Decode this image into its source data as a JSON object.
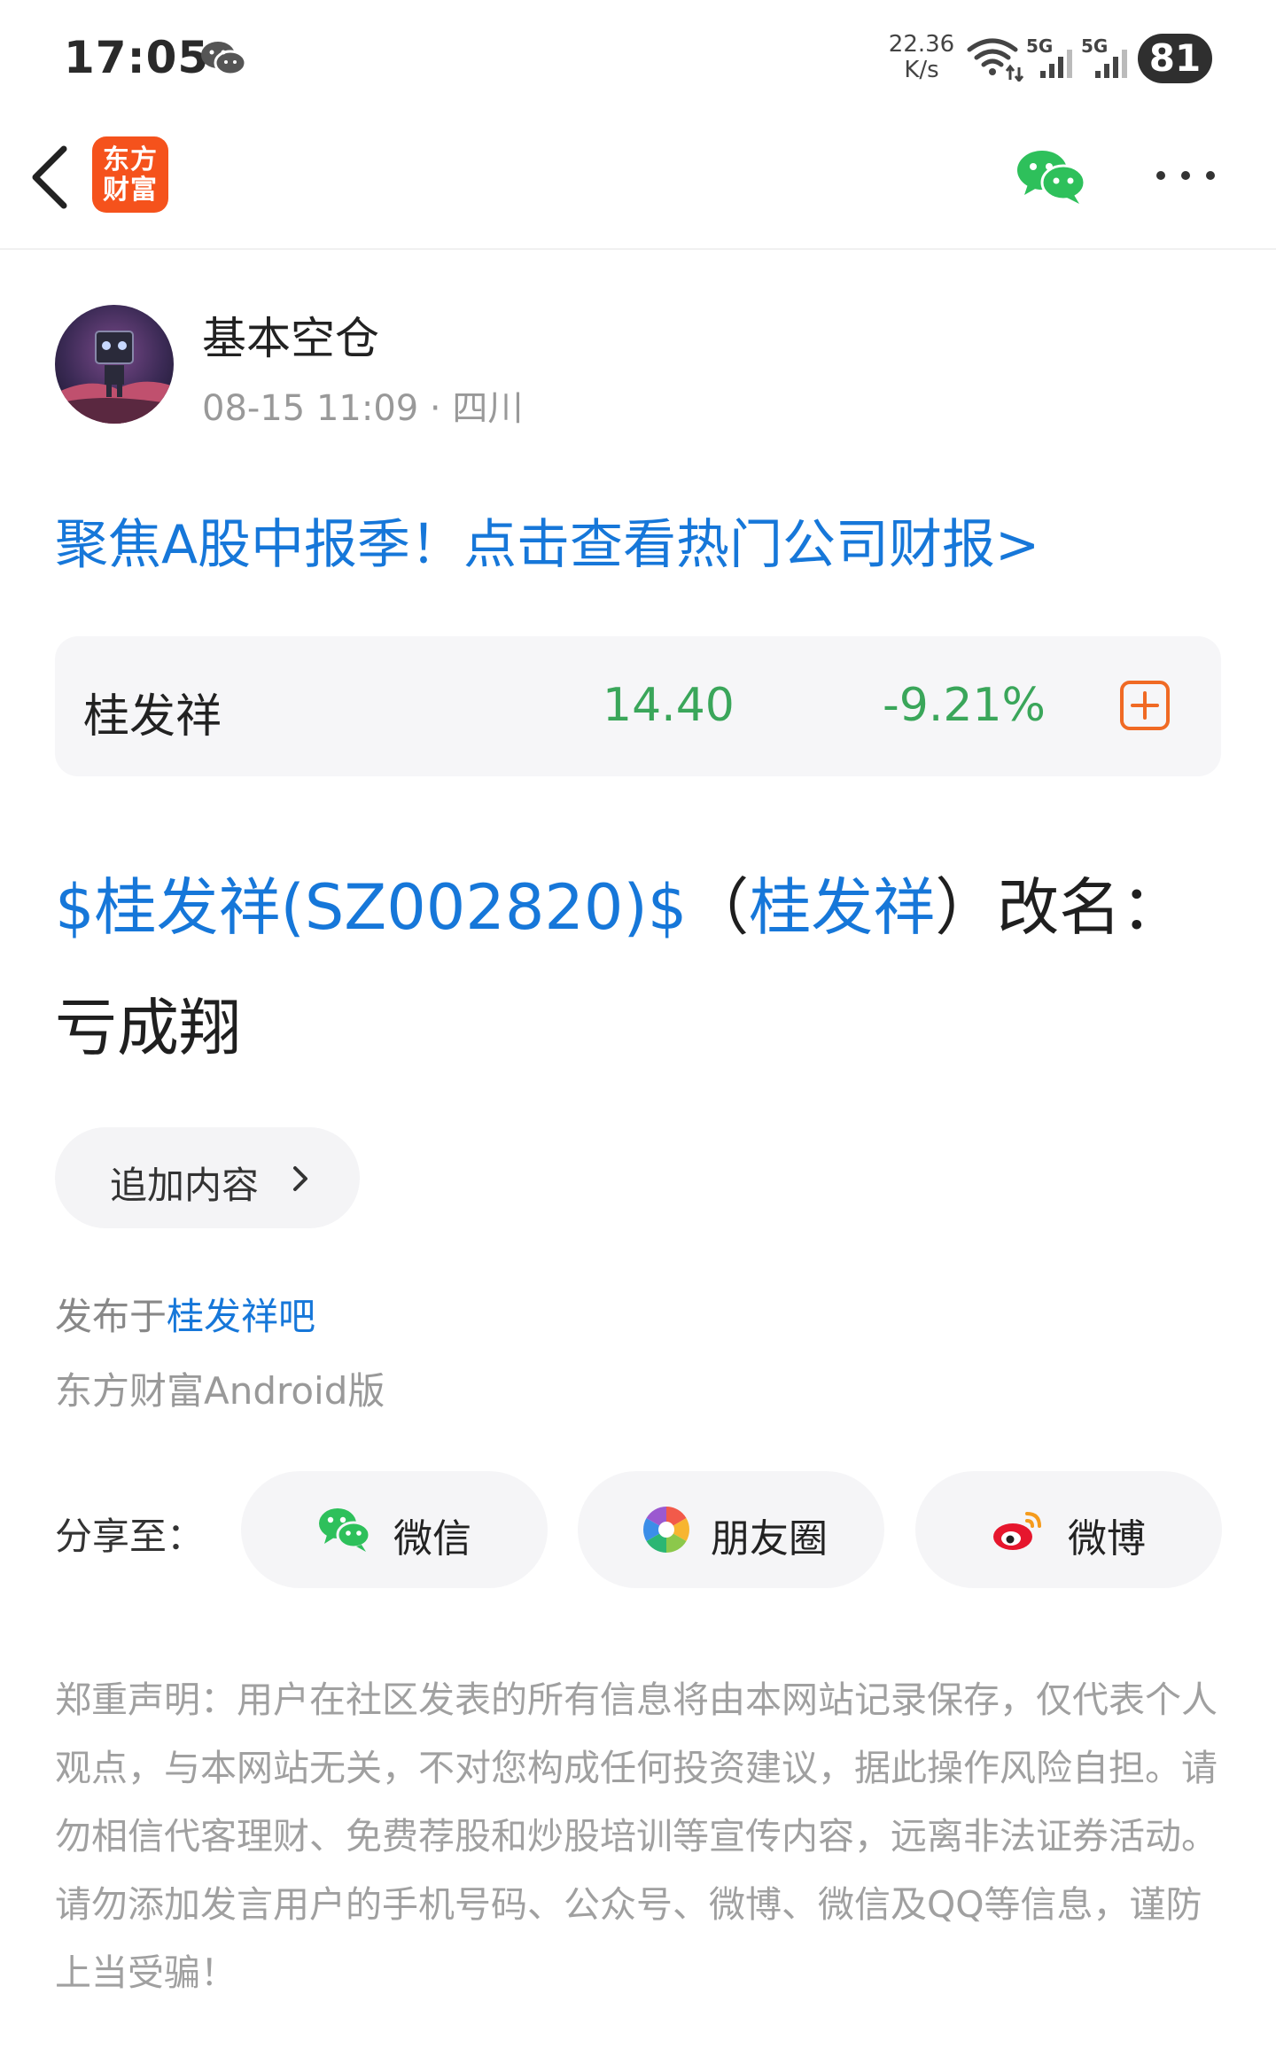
{
  "status_bar": {
    "time": "17:05",
    "net_speed_value": "22.36",
    "net_speed_unit": "K/s",
    "signal_1_label": "5G",
    "signal_2_label": "5G",
    "battery": "81"
  },
  "nav": {
    "logo_line1": "东方",
    "logo_line2": "财富"
  },
  "author": {
    "name": "基本空仓",
    "time": "08-15 11:09",
    "separator": " · ",
    "location": "四川"
  },
  "promo_text": "聚焦A股中报季！点击查看热门公司财报>",
  "stock": {
    "name": "桂发祥",
    "price": "14.40",
    "change": "-9.21%",
    "color_down": "#3aa65a"
  },
  "title": {
    "stock_tag": "$桂发祥(SZ002820)$",
    "paren_open": "（",
    "stock_name": "桂发祥",
    "paren_close": "）",
    "rest": "改名：亏成翔"
  },
  "append_button": "追加内容",
  "published": {
    "prefix": "发布于",
    "bar_name": "桂发祥吧"
  },
  "client_text": "东方财富Android版",
  "share": {
    "label": "分享至：",
    "wechat": "微信",
    "moments": "朋友圈",
    "weibo": "微博"
  },
  "disclaimer": "郑重声明：用户在社区发表的所有信息将由本网站记录保存，仅代表个人观点，与本网站无关，不对您构成任何投资建议，据此操作风险自担。请勿相信代客理财、免费荐股和炒股培训等宣传内容，远离非法证券活动。请勿添加发言用户的手机号码、公众号、微博、微信及QQ等信息，谨防上当受骗！",
  "colors": {
    "link_blue": "#1677d9",
    "brand_orange": "#f5521c",
    "wechat_green": "#2ec05b"
  }
}
